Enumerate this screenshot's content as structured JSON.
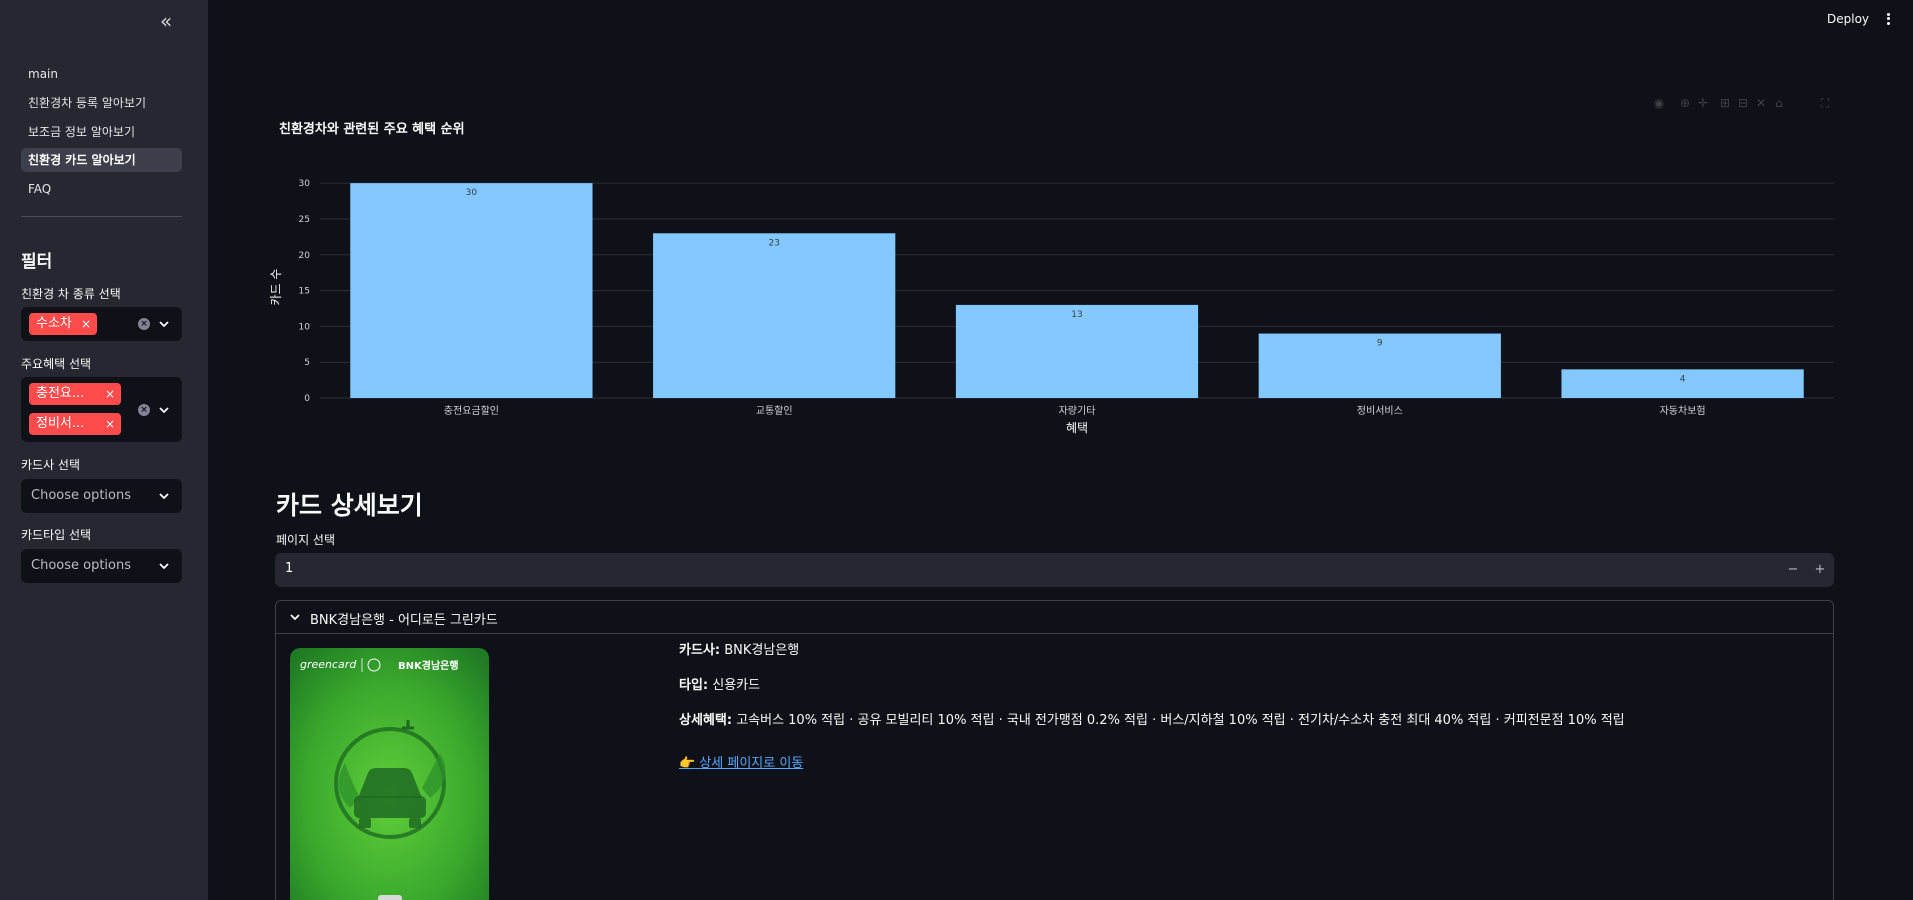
{
  "sidebar": {
    "collapse_label": "«",
    "nav": [
      "main",
      "친환경차 등록 알아보기",
      "보조금 정보 알아보기",
      "친환경 카드 알아보기",
      "FAQ"
    ],
    "active_nav": "친환경 카드 알아보기",
    "filter_title": "필터",
    "filters": {
      "car_type": {
        "label": "친환경 차 종류 선택",
        "selected": [
          "수소차"
        ]
      },
      "benefit": {
        "label": "주요혜택 선택",
        "selected": [
          "충전요...",
          "정비서..."
        ]
      },
      "card_company": {
        "label": "카드사 선택",
        "placeholder": "Choose options"
      },
      "card_type": {
        "label": "카드타입 선택",
        "placeholder": "Choose options"
      }
    }
  },
  "header": {
    "deploy_label": "Deploy"
  },
  "chart": {
    "title": "친환경차와 관련된 주요 혜택 순위"
  },
  "chart_data": {
    "type": "bar",
    "title": "친환경차와 관련된 주요 혜택 순위",
    "categories": [
      "충전요금할인",
      "교통할인",
      "자량기타",
      "정비서비스",
      "자동차보험"
    ],
    "values": [
      30,
      23,
      13,
      9,
      4
    ],
    "xlabel": "혜택",
    "ylabel": "카드 수",
    "ylim": [
      0,
      31
    ],
    "yticks": [
      0,
      5,
      10,
      15,
      20,
      25,
      30
    ],
    "grid": true,
    "color": "#83c9ff"
  },
  "detail": {
    "section_title": "카드 상세보기",
    "page_label": "페이지 선택",
    "page_value": "1",
    "minus": "−",
    "plus": "+",
    "expander_title": "BNK경남은행 - 어디로든 그린카드",
    "card_logo_left": "greencard",
    "card_logo_right": "BNK경남은행",
    "company_label": "카드사:",
    "company_value": "BNK경남은행",
    "type_label": "타입:",
    "type_value": "신용카드",
    "benefit_label": "상세혜택:",
    "benefit_value": "고속버스 10% 적립 · 공유 모빌리티 10% 적립 · 국내 전가맹점 0.2% 적립 · 버스/지하철 10% 적립 · 전기차/수소차 충전 최대 40% 적립 · 커피전문점 10% 적립",
    "link_emoji": "👉",
    "link_text": "상세 페이지로 이동"
  }
}
